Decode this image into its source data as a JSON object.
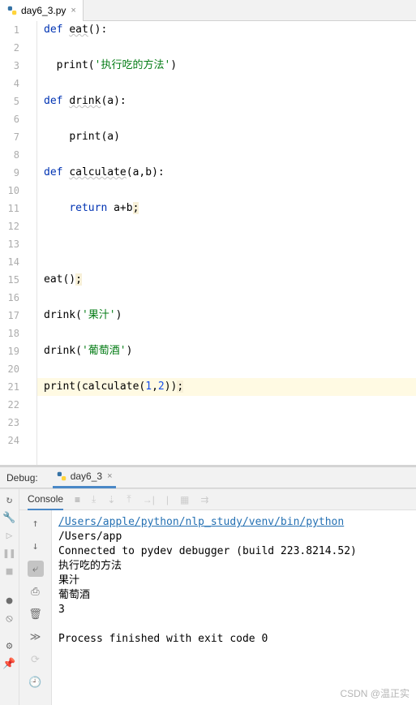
{
  "tab": {
    "filename": "day6_3.py",
    "close": "×"
  },
  "code": {
    "lines": [
      {
        "n": "1",
        "indent": "",
        "tokens": [
          {
            "t": "def ",
            "c": "kw"
          },
          {
            "t": "eat",
            "c": "fn"
          },
          {
            "t": "():",
            "c": ""
          }
        ]
      },
      {
        "n": "2",
        "indent": "",
        "tokens": []
      },
      {
        "n": "3",
        "indent": "  ",
        "tokens": [
          {
            "t": "print",
            "c": "builtin"
          },
          {
            "t": "(",
            "c": ""
          },
          {
            "t": "'执行吃的方法'",
            "c": "str"
          },
          {
            "t": ")",
            "c": ""
          }
        ]
      },
      {
        "n": "4",
        "indent": "",
        "tokens": []
      },
      {
        "n": "5",
        "indent": "",
        "tokens": [
          {
            "t": "def ",
            "c": "kw"
          },
          {
            "t": "drink",
            "c": "fn"
          },
          {
            "t": "(a):",
            "c": ""
          }
        ]
      },
      {
        "n": "6",
        "indent": "",
        "tokens": []
      },
      {
        "n": "7",
        "indent": "    ",
        "tokens": [
          {
            "t": "print",
            "c": "builtin"
          },
          {
            "t": "(a)",
            "c": ""
          }
        ]
      },
      {
        "n": "8",
        "indent": "",
        "tokens": []
      },
      {
        "n": "9",
        "indent": "",
        "tokens": [
          {
            "t": "def ",
            "c": "kw"
          },
          {
            "t": "calculate",
            "c": "fn"
          },
          {
            "t": "(a,b):",
            "c": ""
          }
        ]
      },
      {
        "n": "10",
        "indent": "",
        "tokens": []
      },
      {
        "n": "11",
        "indent": "    ",
        "tokens": [
          {
            "t": "return ",
            "c": "kw"
          },
          {
            "t": "a+b",
            "c": ""
          },
          {
            "t": ";",
            "c": "warn-bg"
          }
        ]
      },
      {
        "n": "12",
        "indent": "",
        "tokens": []
      },
      {
        "n": "13",
        "indent": "",
        "tokens": []
      },
      {
        "n": "14",
        "indent": "",
        "tokens": []
      },
      {
        "n": "15",
        "indent": "",
        "tokens": [
          {
            "t": "eat()",
            "c": ""
          },
          {
            "t": ";",
            "c": "warn-bg"
          }
        ]
      },
      {
        "n": "16",
        "indent": "",
        "tokens": []
      },
      {
        "n": "17",
        "indent": "",
        "tokens": [
          {
            "t": "drink(",
            "c": ""
          },
          {
            "t": "'果汁'",
            "c": "str"
          },
          {
            "t": ")",
            "c": ""
          }
        ]
      },
      {
        "n": "18",
        "indent": "",
        "tokens": []
      },
      {
        "n": "19",
        "indent": "",
        "tokens": [
          {
            "t": "drink(",
            "c": ""
          },
          {
            "t": "'葡萄酒'",
            "c": "str"
          },
          {
            "t": ")",
            "c": ""
          }
        ]
      },
      {
        "n": "20",
        "indent": "",
        "tokens": []
      },
      {
        "n": "21",
        "indent": "",
        "tokens": [
          {
            "t": "print",
            "c": "builtin"
          },
          {
            "t": "(calculate(",
            "c": ""
          },
          {
            "t": "1",
            "c": "num"
          },
          {
            "t": ",",
            "c": ""
          },
          {
            "t": "2",
            "c": "num"
          },
          {
            "t": "))",
            "c": ""
          },
          {
            "t": ";",
            "c": "warn-bg"
          }
        ],
        "hl": true
      },
      {
        "n": "22",
        "indent": "",
        "tokens": []
      },
      {
        "n": "23",
        "indent": "",
        "tokens": []
      },
      {
        "n": "24",
        "indent": "",
        "tokens": []
      }
    ]
  },
  "debug": {
    "label": "Debug:",
    "config_name": "day6_3",
    "close": "×",
    "console_tab": "Console"
  },
  "console": {
    "path_link": "/Users/apple/python/nlp_study/venv/bin/python",
    "path_rest": " /Users/app",
    "lines": [
      "Connected to pydev debugger (build 223.8214.52)",
      "执行吃的方法",
      "果汁",
      "葡萄酒",
      "3",
      "",
      "Process finished with exit code 0"
    ]
  },
  "watermark": "CSDN @温正实"
}
